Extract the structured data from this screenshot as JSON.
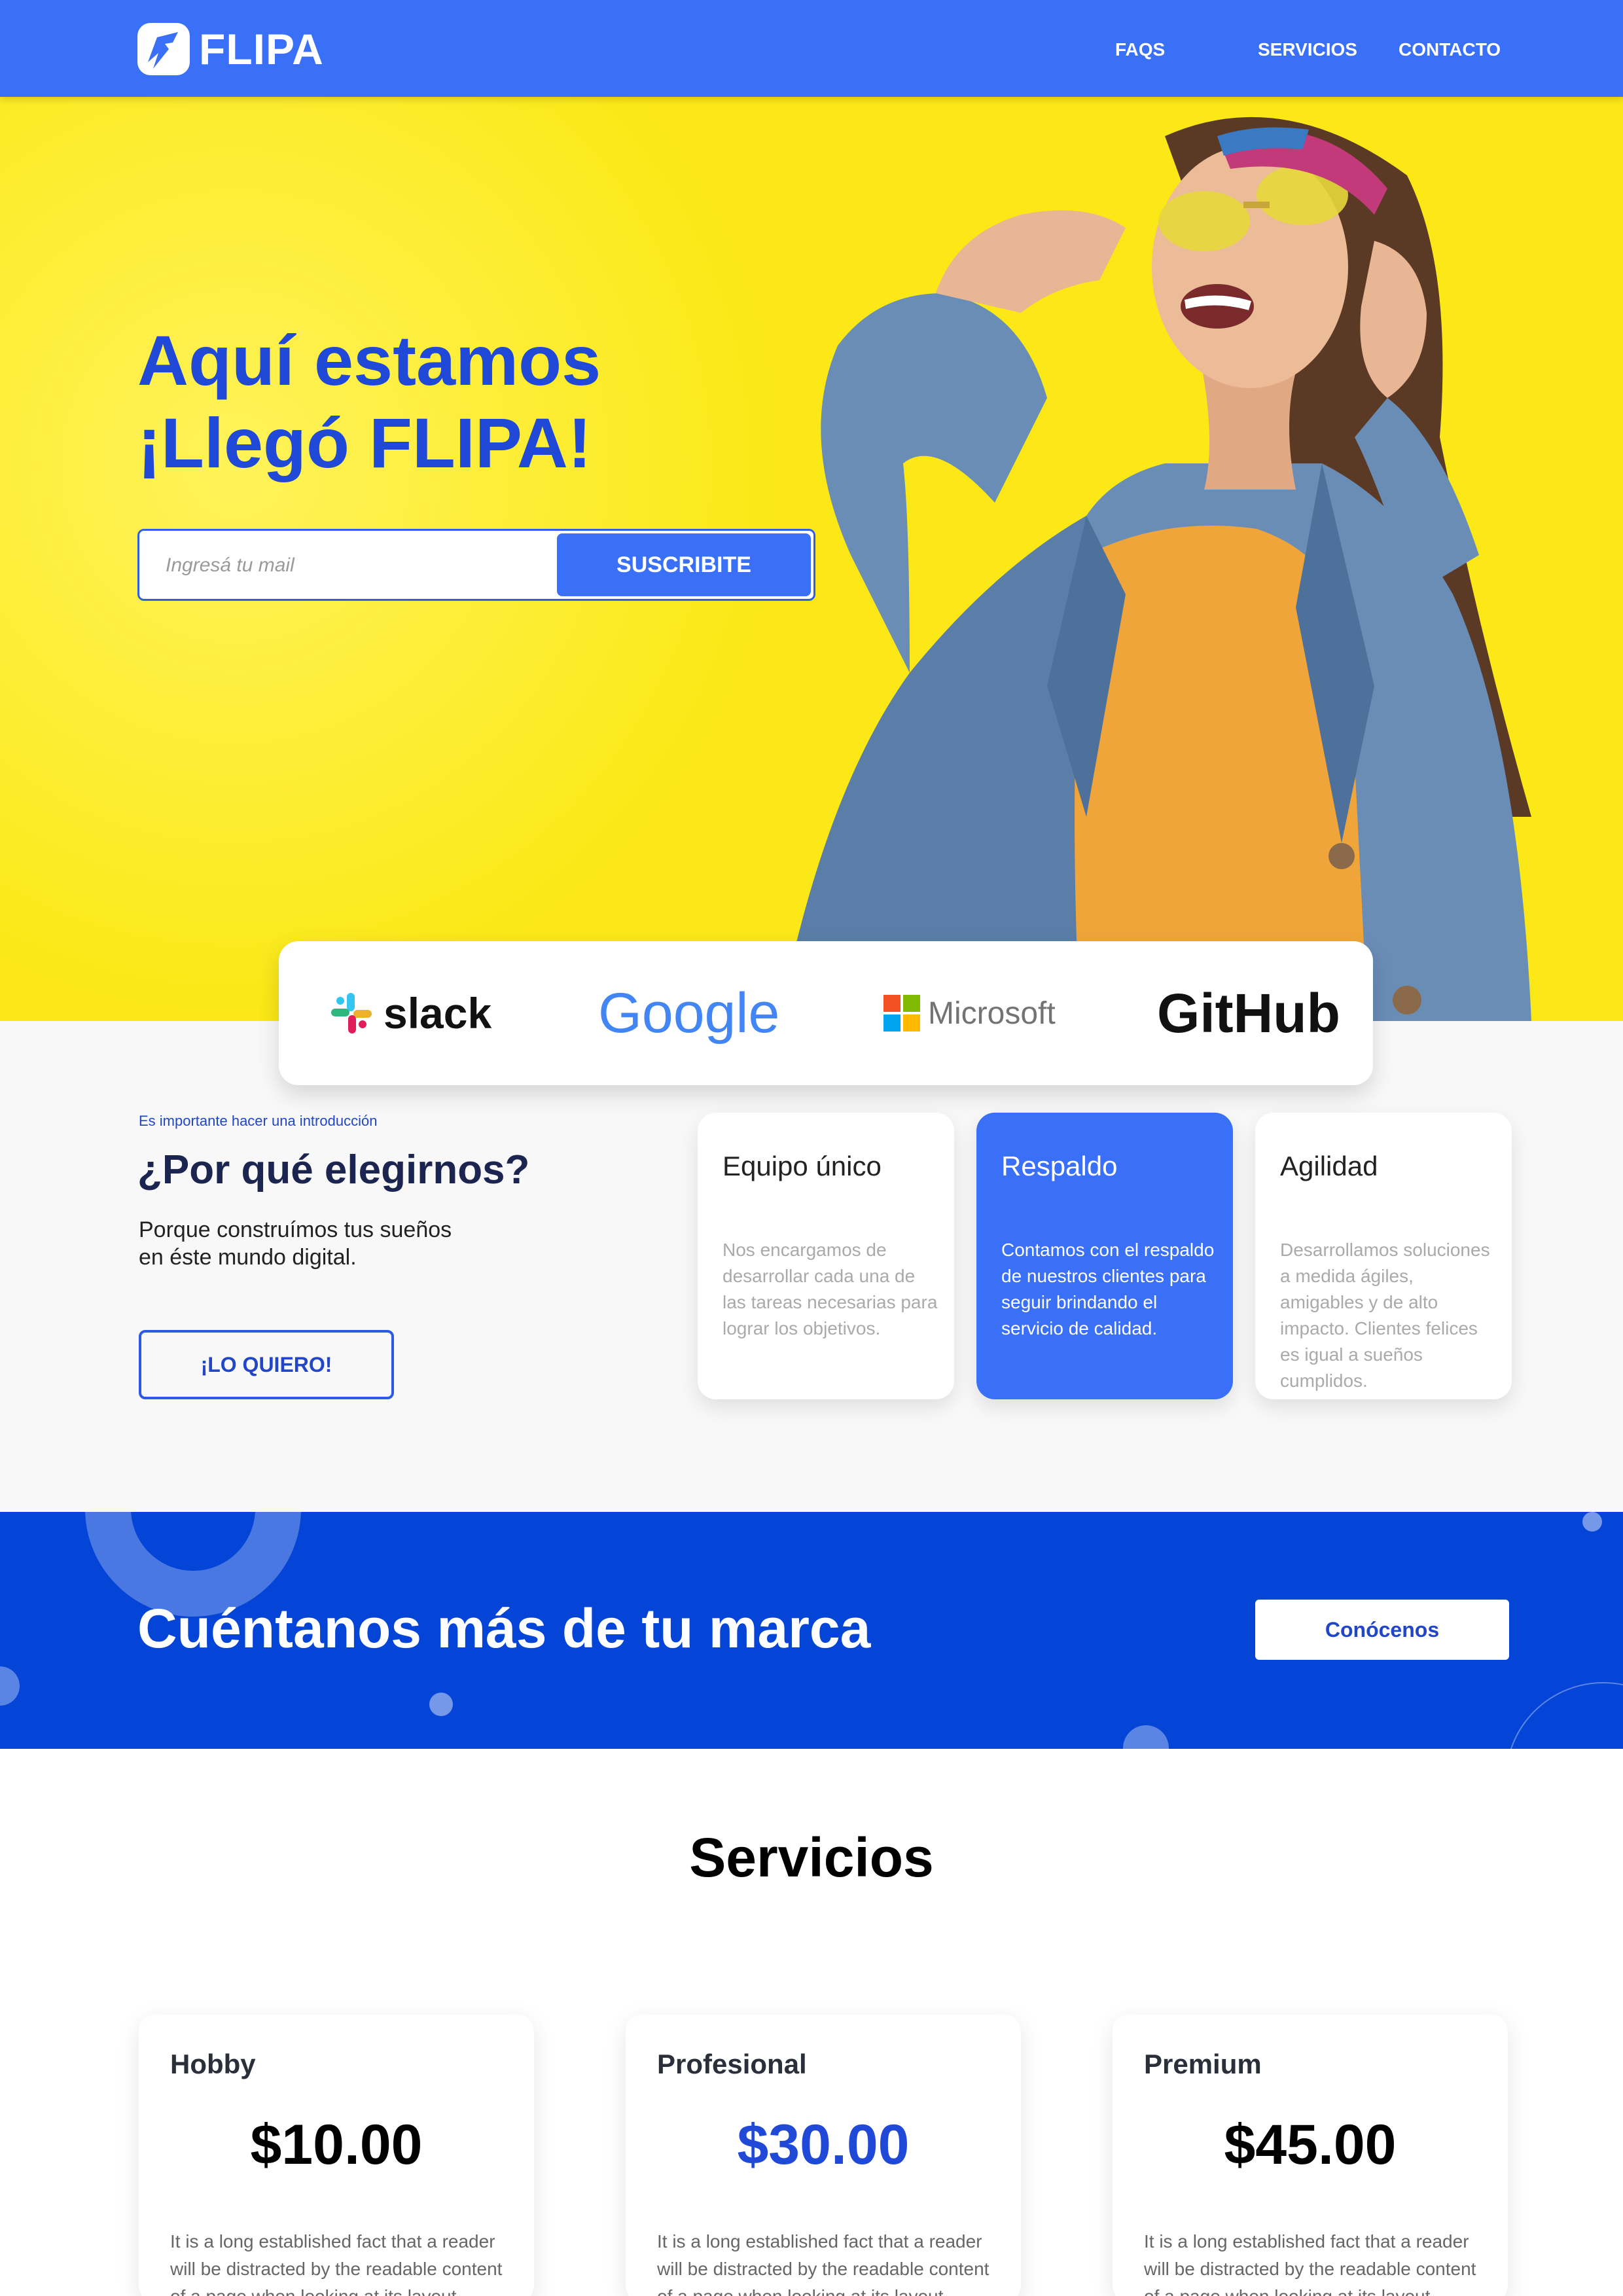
{
  "header": {
    "brand": "FLIPA",
    "nav": [
      "FAQS",
      "SERVICIOS",
      "CONTACTO"
    ]
  },
  "hero": {
    "title_line1": "Aquí estamos",
    "title_line2": "¡Llegó FLIPA!",
    "email_placeholder": "Ingresá tu mail",
    "subscribe_label": "SUSCRIBITE"
  },
  "brands": [
    "slack",
    "Google",
    "Microsoft",
    "GitHub"
  ],
  "intro": {
    "eyebrow": "Es importante hacer una introducción",
    "title": "¿Por qué elegirnos?",
    "text_line1": "Porque construímos tus sueños",
    "text_line2": "en éste mundo digital.",
    "button_label": "¡LO QUIERO!"
  },
  "features": [
    {
      "title": "Equipo único",
      "text": "Nos encargamos de desarrollar cada una de las tareas necesarias para lograr los objetivos."
    },
    {
      "title": "Respaldo",
      "text": "Contamos con el respaldo de nuestros clientes para seguir brindando el servicio de calidad."
    },
    {
      "title": "Agilidad",
      "text": "Desarrollamos soluciones a medida ágiles, amigables y de alto impacto. Clientes felices es igual a sueños cumplidos."
    }
  ],
  "cta": {
    "title": "Cuéntanos más de tu marca",
    "button_label": "Conócenos"
  },
  "services": {
    "title": "Servicios",
    "plans": [
      {
        "name": "Hobby",
        "price": "$10.00",
        "desc": "It is a long established fact that a reader will be distracted by the readable content of a page when looking at its layout."
      },
      {
        "name": "Profesional",
        "price": "$30.00",
        "desc": "It is a long established fact that a reader will be distracted by the readable content of a page when looking at its layout."
      },
      {
        "name": "Premium",
        "price": "$45.00",
        "desc": "It is a long established fact that a reader will be distracted by the readable content of a page when looking at its layout."
      }
    ]
  },
  "colors": {
    "primary": "#3a6ff7",
    "dark_blue": "#0444d7",
    "heading_blue": "#1f49d6",
    "hero_yellow": "#fbe816"
  }
}
